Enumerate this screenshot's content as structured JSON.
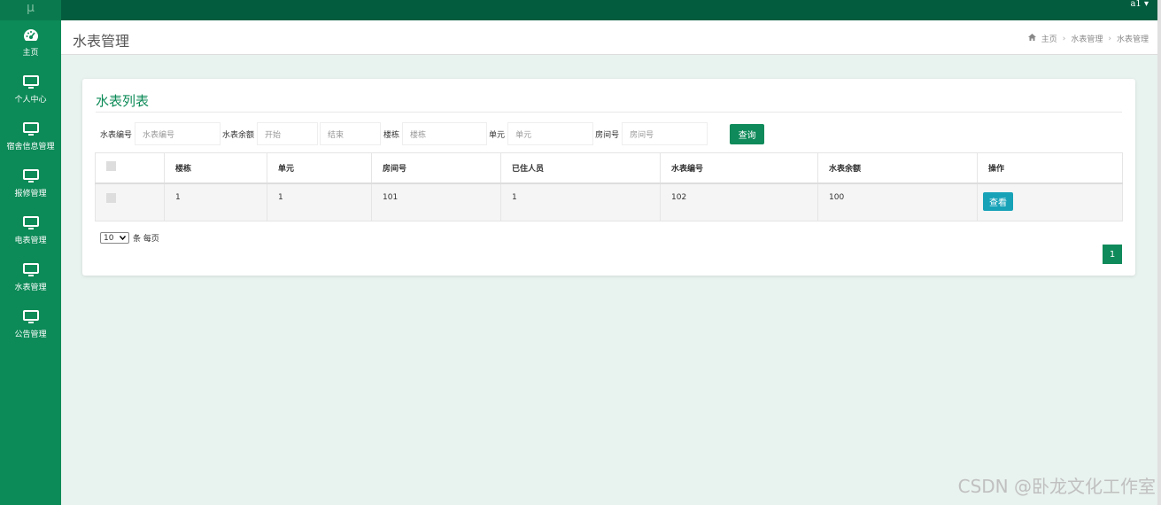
{
  "topbar": {
    "logo": "μ",
    "user": "a1 ▾"
  },
  "sidebar": {
    "items": [
      {
        "label": "主页",
        "icon": "dashboard-icon"
      },
      {
        "label": "个人中心",
        "icon": "monitor-icon"
      },
      {
        "label": "宿舍信息管理",
        "icon": "monitor-icon"
      },
      {
        "label": "报修管理",
        "icon": "monitor-icon"
      },
      {
        "label": "电表管理",
        "icon": "monitor-icon"
      },
      {
        "label": "水表管理",
        "icon": "monitor-icon"
      },
      {
        "label": "公告管理",
        "icon": "monitor-icon"
      }
    ]
  },
  "header": {
    "title": "水表管理",
    "breadcrumb": [
      "主页",
      "水表管理",
      "水表管理"
    ]
  },
  "card": {
    "title": "水表列表",
    "search": {
      "meter_no_label": "水表编号",
      "meter_no_placeholder": "水表编号",
      "balance_label": "水表余额",
      "balance_start_placeholder": "开始",
      "balance_end_placeholder": "结束",
      "building_label": "楼栋",
      "building_placeholder": "楼栋",
      "unit_label": "单元",
      "unit_placeholder": "单元",
      "room_label": "房间号",
      "room_placeholder": "房间号",
      "query_button": "查询"
    },
    "table": {
      "headers": [
        "楼栋",
        "单元",
        "房间号",
        "已住人员",
        "水表编号",
        "水表余额",
        "操作"
      ],
      "rows": [
        {
          "building": "1",
          "unit": "1",
          "room": "101",
          "occupants": "1",
          "meter_no": "102",
          "balance": "100",
          "action": "查看"
        }
      ]
    },
    "page_size": {
      "value": "10",
      "suffix": "条 每页"
    },
    "pagination": {
      "current": "1"
    }
  },
  "watermark": "CSDN @卧龙文化工作室",
  "colors": {
    "primary": "#0c8a57",
    "topbar": "#045c3f",
    "info": "#17a2b8"
  }
}
